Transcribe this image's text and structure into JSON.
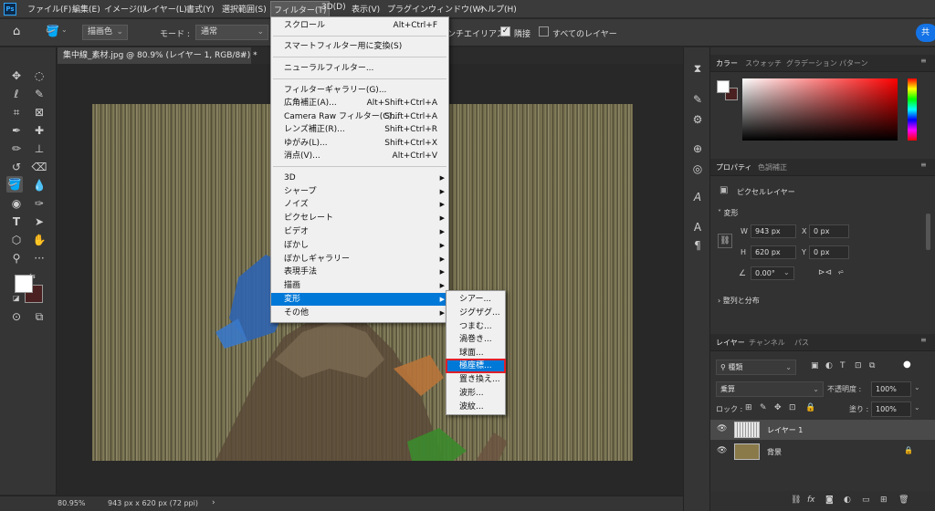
{
  "menubar": {
    "logo": "Ps",
    "items": [
      "ファイル(F)",
      "編集(E)",
      "イメージ(I)",
      "レイヤー(L)",
      "書式(Y)",
      "選択範囲(S)",
      "フィルター(T)",
      "3D(D)",
      "表示(V)",
      "プラグイン",
      "ウィンドウ(W)",
      "ヘルプ(H)"
    ]
  },
  "options": {
    "paint_source": "描画色",
    "mode_label": "モード :",
    "mode_value": "通常",
    "antialias_label": "ンチエイリアス",
    "contiguous_label": "隣接",
    "all_layers_label": "すべてのレイヤー",
    "share_label": "共"
  },
  "document": {
    "tab_title": "集中線_素材.jpg @ 80.9% (レイヤー 1, RGB/8#) *",
    "close": "×"
  },
  "status": {
    "zoom": "80.95%",
    "size": "943 px x 620 px (72 ppi)",
    "arrow": "›"
  },
  "filter_menu": {
    "top": [
      {
        "label": "スクロール",
        "shortcut": "Alt+Ctrl+F"
      }
    ],
    "smart": [
      {
        "label": "スマートフィルター用に変換(S)",
        "shortcut": ""
      }
    ],
    "neural": [
      {
        "label": "ニューラルフィルター...",
        "shortcut": ""
      }
    ],
    "group2": [
      {
        "label": "フィルターギャラリー(G)...",
        "shortcut": ""
      },
      {
        "label": "広角補正(A)...",
        "shortcut": "Alt+Shift+Ctrl+A"
      },
      {
        "label": "Camera Raw フィルター(C)...",
        "shortcut": "Shift+Ctrl+A"
      },
      {
        "label": "レンズ補正(R)...",
        "shortcut": "Shift+Ctrl+R"
      },
      {
        "label": "ゆがみ(L)...",
        "shortcut": "Shift+Ctrl+X"
      },
      {
        "label": "消点(V)...",
        "shortcut": "Alt+Ctrl+V"
      }
    ],
    "group3": [
      {
        "label": "3D"
      },
      {
        "label": "シャープ"
      },
      {
        "label": "ノイズ"
      },
      {
        "label": "ピクセレート"
      },
      {
        "label": "ビデオ"
      },
      {
        "label": "ぼかし"
      },
      {
        "label": "ぼかしギャラリー"
      },
      {
        "label": "表現手法"
      },
      {
        "label": "描画"
      },
      {
        "label": "変形"
      },
      {
        "label": "その他"
      }
    ],
    "highlighted": "変形"
  },
  "distort_submenu": {
    "items": [
      "シアー...",
      "ジグザグ...",
      "つまむ...",
      "渦巻き...",
      "球面...",
      "極座標...",
      "置き換え...",
      "波形...",
      "波紋..."
    ],
    "highlighted": "極座標..."
  },
  "color_panel": {
    "tabs": [
      "カラー",
      "スウォッチ",
      "グラデーション",
      "パターン"
    ],
    "fg": "#ffffff",
    "bg": "#4a2020",
    "hue": "#ff0000"
  },
  "properties_panel": {
    "tabs": [
      "プロパティ",
      "色調補正"
    ],
    "layer_type": "ピクセルレイヤー",
    "section_transform": "変形",
    "w_label": "W",
    "w_value": "943 px",
    "h_label": "H",
    "h_value": "620 px",
    "x_label": "X",
    "x_value": "0 px",
    "y_label": "Y",
    "y_value": "0 px",
    "angle_value": "0.00°",
    "section_align": "整列と分布"
  },
  "layers_panel": {
    "tabs": [
      "レイヤー",
      "チャンネル",
      "パス"
    ],
    "filter_kind": "種類",
    "blend_mode": "乗算",
    "opacity_label": "不透明度 :",
    "opacity_value": "100%",
    "lock_label": "ロック :",
    "fill_label": "塗り :",
    "fill_value": "100%",
    "layers": [
      {
        "name": "レイヤー 1"
      },
      {
        "name": "背景"
      }
    ]
  },
  "accent": "#0078d7",
  "highlight_box": "#e0202a"
}
